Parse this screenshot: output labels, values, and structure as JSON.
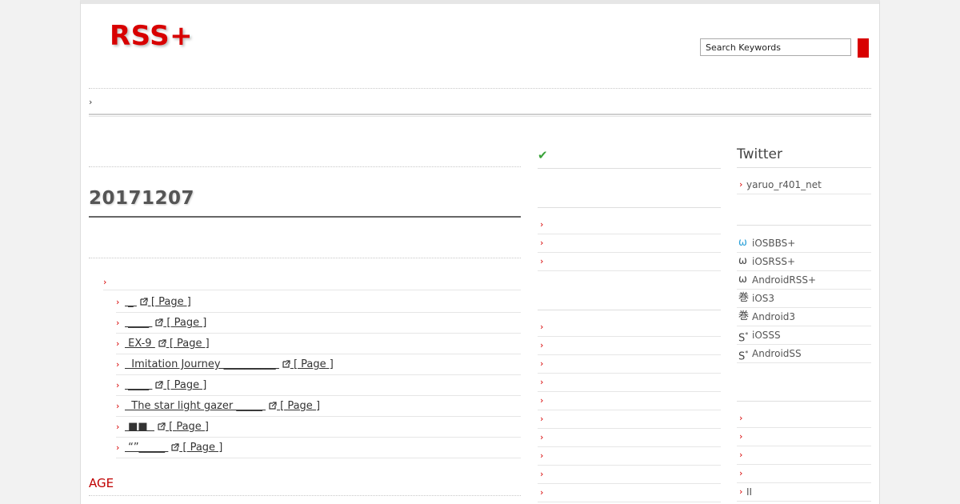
{
  "header": {
    "logo": "RSS+",
    "search": {
      "placeholder": "Search Keywords",
      "value": "Search Keywords"
    }
  },
  "nav": {
    "arrow": "›"
  },
  "main": {
    "post_title": "20171207",
    "category_arrow": "›",
    "entries": [
      {
        "title": " _ ",
        "page_label": "Page"
      },
      {
        "title": " ____ ",
        "page_label": "Page"
      },
      {
        "title": " EX-9 ",
        "page_label": "Page"
      },
      {
        "title": "  Imitation Journey __________ ",
        "page_label": "Page"
      },
      {
        "title": " ____ ",
        "page_label": "Page"
      },
      {
        "title": "  The star light gazer _____ ",
        "page_label": "Page"
      },
      {
        "title": " ■■  ",
        "page_label": "Page"
      },
      {
        "title": " “”_____ ",
        "page_label": "Page"
      }
    ],
    "age_heading": "AGE"
  },
  "middle": {
    "check_icon": "✔",
    "items_a_count_note": "",
    "arrow": "›"
  },
  "right": {
    "twitter_title": "Twitter",
    "twitter_account": "yaruo_r401_net",
    "apps": [
      {
        "icon": "ω",
        "icon_name": "omega-icon",
        "label": "iOSBBS+",
        "blue": true
      },
      {
        "icon": "ω",
        "icon_name": "omega-icon",
        "label": "iOSRSS+",
        "blue": false
      },
      {
        "icon": "ω",
        "icon_name": "omega-icon",
        "label": "AndroidRSS+",
        "blue": false
      },
      {
        "icon": "巻",
        "icon_name": "scroll-kanji-icon",
        "label": "iOS3",
        "blue": false
      },
      {
        "icon": "巻",
        "icon_name": "scroll-kanji-icon",
        "label": "Android3",
        "blue": false
      },
      {
        "icon": "S*",
        "icon_name": "s-star-icon",
        "label": "iOSSS",
        "blue": false
      },
      {
        "icon": "S*",
        "icon_name": "s-star-icon",
        "label": "AndroidSS",
        "blue": false
      }
    ],
    "bottom_items": [
      "",
      "",
      "",
      "",
      "II"
    ]
  },
  "colors": {
    "accent": "#d80000",
    "check": "#3aa33a",
    "omega_blue": "#2aa0d8"
  }
}
